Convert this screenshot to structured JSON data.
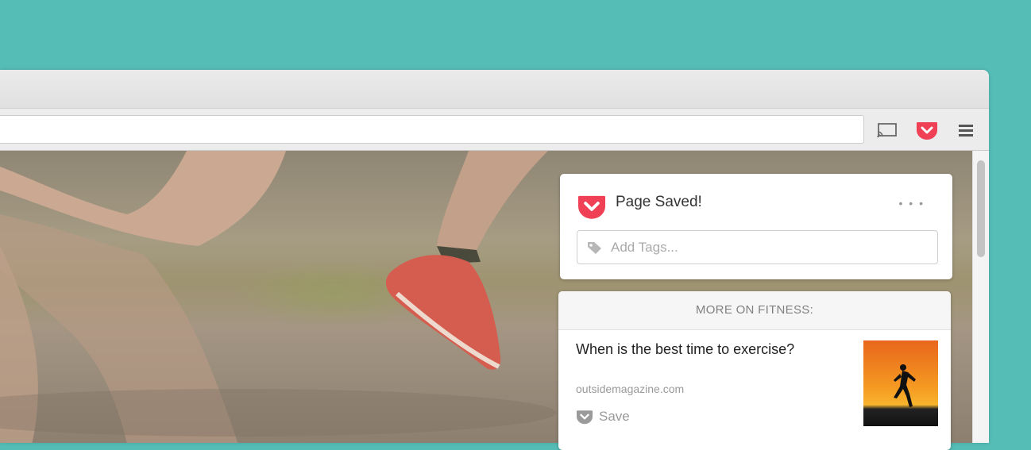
{
  "toolbar": {
    "cast_icon": "cast-icon",
    "pocket_icon": "pocket-icon",
    "menu_icon": "hamburger-menu-icon",
    "pocket_color": "#ef4056"
  },
  "pocket_panel": {
    "saved_title": "Page Saved!",
    "more_options": "• • •",
    "tags_placeholder": "Add Tags...",
    "more_header": "MORE ON FITNESS:",
    "recommendation": {
      "title": "When is the best time to exercise?",
      "source": "outsidemagazine.com",
      "save_label": "Save"
    }
  }
}
